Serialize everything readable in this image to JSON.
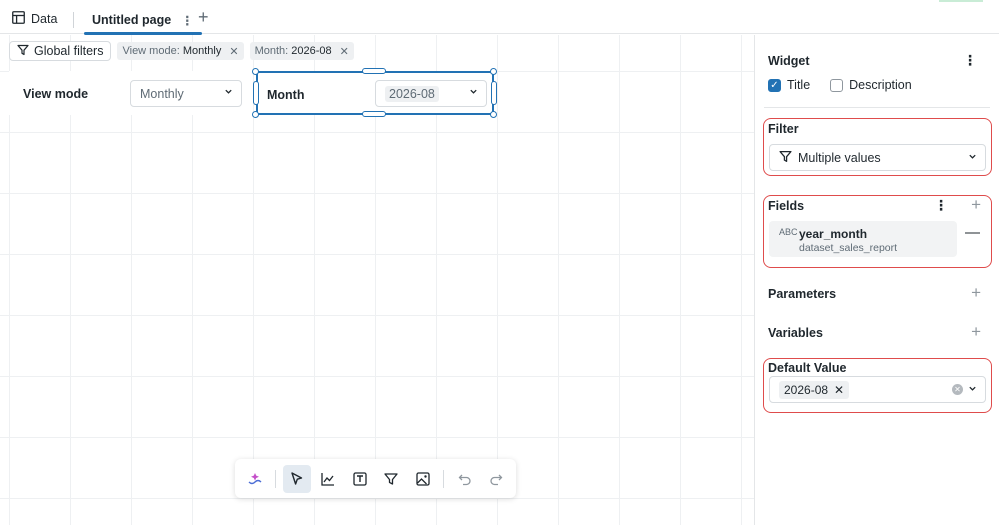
{
  "tabs": {
    "data_label": "Data",
    "page_label": "Untitled page",
    "kebab": "⋮",
    "add": "+"
  },
  "filterbar": {
    "global_filters_label": "Global filters",
    "chips": [
      {
        "label": "View mode:",
        "value": "Monthly"
      },
      {
        "label": "Month:",
        "value": "2026-08"
      }
    ]
  },
  "widgets": [
    {
      "title": "View mode",
      "value": "Monthly"
    },
    {
      "title": "Month",
      "value": "2026-08"
    }
  ],
  "toolbar": {
    "tools": [
      "ai-assistant-icon",
      "select-pointer-icon",
      "line-chart-icon",
      "text-box-icon",
      "filter-icon",
      "image-icon",
      "undo-icon",
      "redo-icon"
    ],
    "active": "select-pointer-icon"
  },
  "panel": {
    "widget_heading": "Widget",
    "title_checkbox": {
      "label": "Title",
      "checked": true
    },
    "description_checkbox": {
      "label": "Description",
      "checked": false
    },
    "filter_heading": "Filter",
    "filter_value": "Multiple values",
    "fields_heading": "Fields",
    "field": {
      "type_glyph": "ABC",
      "name": "year_month",
      "source": "dataset_sales_report"
    },
    "parameters_heading": "Parameters",
    "variables_heading": "Variables",
    "default_value_heading": "Default Value",
    "default_value": "2026-08"
  },
  "colors": {
    "accent": "#2272b4",
    "highlight_border": "#df4c4c"
  }
}
